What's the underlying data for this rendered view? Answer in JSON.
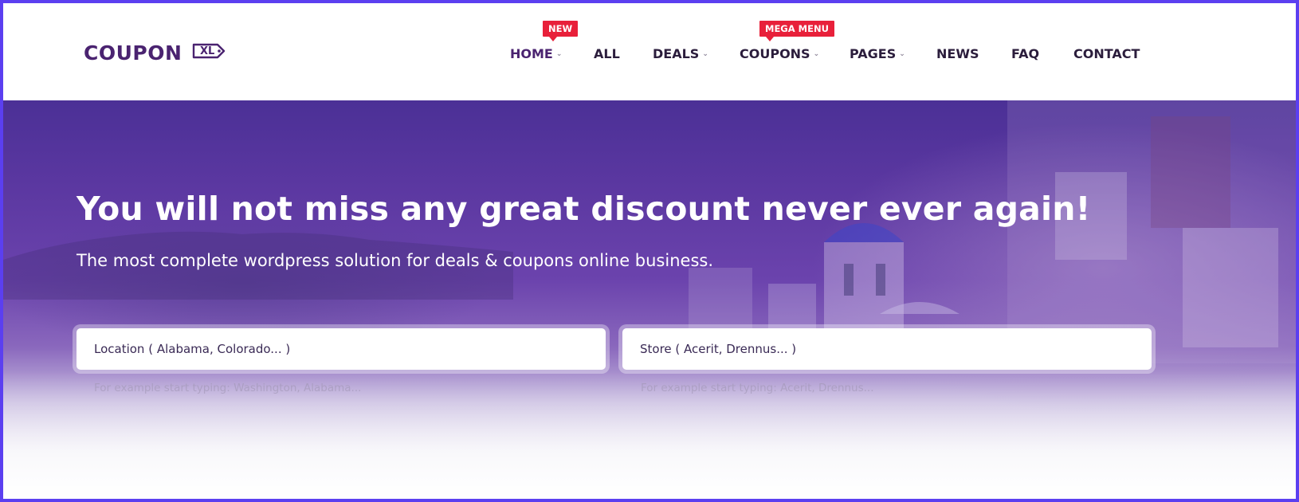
{
  "colors": {
    "frame": "#5b3ff0",
    "brand_purple": "#4a2370",
    "badge_red": "#e8203a",
    "nav_text": "#2b1d3c",
    "hero_purple": "#5a37a0"
  },
  "header": {
    "logo": {
      "text": "COUPON",
      "tag": "XL",
      "icon": "coupon-tag-logo-icon"
    },
    "nav": [
      {
        "label": "HOME",
        "caret": "⌄",
        "badge": "NEW",
        "active": true
      },
      {
        "label": "ALL"
      },
      {
        "label": "DEALS",
        "caret": "⌄"
      },
      {
        "label": "COUPONS",
        "caret": "⌄",
        "badge": "MEGA MENU"
      },
      {
        "label": "PAGES",
        "caret": "⌄"
      },
      {
        "label": "NEWS"
      },
      {
        "label": "FAQ"
      },
      {
        "label": "CONTACT"
      }
    ]
  },
  "hero": {
    "title": "You will not miss any great discount never ever again!",
    "subtitle": "The most complete wordpress solution for deals & coupons online business.",
    "location_search": {
      "placeholder": "Location ( Alabama, Colorado... )",
      "hint": "For example start typing: Washington, Alabama..."
    },
    "store_search": {
      "placeholder": "Store ( Acerit, Drennus... )",
      "hint": "For example start typing: Acerit, Drennus..."
    }
  }
}
